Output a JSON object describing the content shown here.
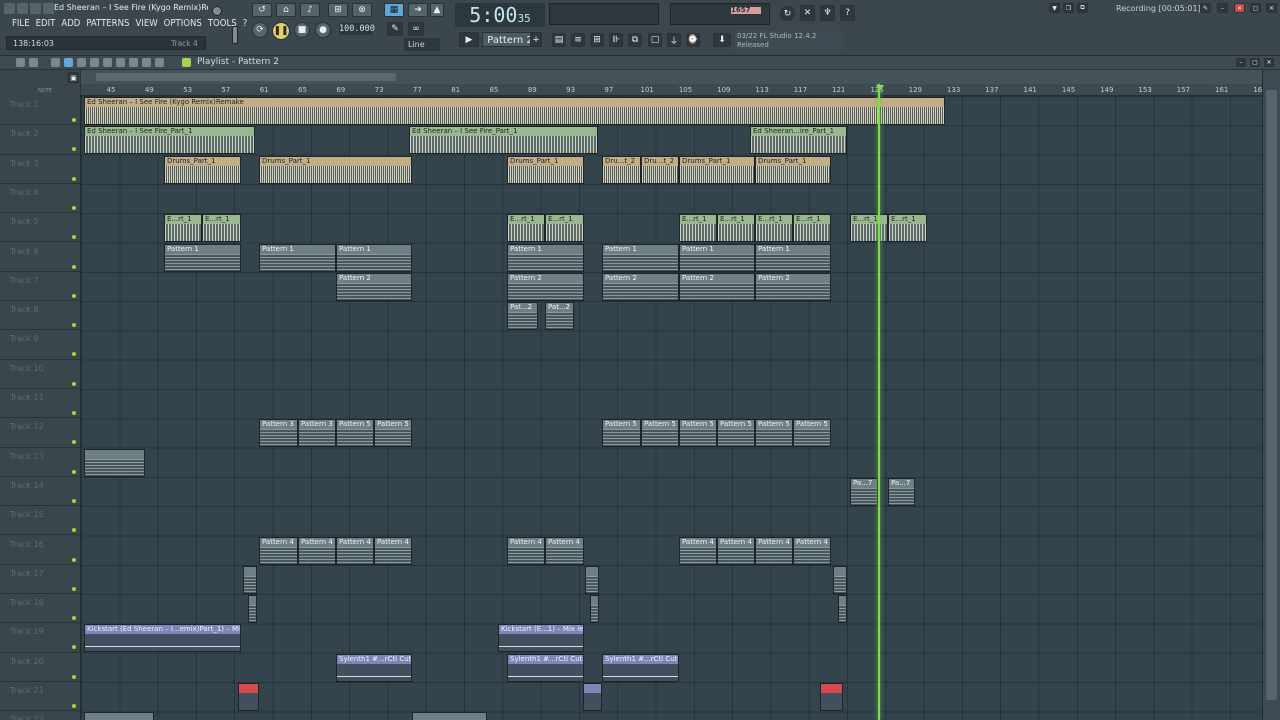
{
  "window": {
    "title": "Ed Sheeran – I See Fire (Kygo Remix)Remake"
  },
  "menu": [
    "FILE",
    "EDIT",
    "ADD",
    "PATTERNS",
    "VIEW",
    "OPTIONS",
    "TOOLS",
    "?"
  ],
  "status": {
    "time": "138:16:03",
    "hint_track": "Track 4"
  },
  "transport": {
    "time_main": "5:00",
    "time_sub": "35",
    "tempo": "100.000",
    "pattern": "Pattern 2",
    "snap": "Line"
  },
  "cpu": {
    "value": "1657"
  },
  "hint_panel": {
    "line1": "03/22  FL Studio 12.4.2",
    "line2": "Released"
  },
  "recording": "Recording [00:05:01]",
  "playlist": {
    "title": "Playlist - Pattern 2",
    "bars": [
      "45",
      "49",
      "53",
      "57",
      "61",
      "65",
      "69",
      "73",
      "77",
      "81",
      "85",
      "89",
      "93",
      "97",
      "101",
      "105",
      "109",
      "113",
      "117",
      "121",
      "125",
      "129",
      "133",
      "137",
      "141",
      "145",
      "149",
      "153",
      "157",
      "161",
      "165"
    ],
    "tracks": [
      "Track 1",
      "Track 2",
      "Track 3",
      "Track 4",
      "Track 5",
      "Track 6",
      "Track 7",
      "Track 8",
      "Track 9",
      "Track 10",
      "Track 11",
      "Track 12",
      "Track 13",
      "Track 14",
      "Track 15",
      "Track 16",
      "Track 17",
      "Track 18",
      "Track 19",
      "Track 20",
      "Track 21",
      "Track 22"
    ]
  },
  "clips": {
    "t1": "Ed Sheeran – I See Fire (Kygo Remix)Remake",
    "t2a": "Ed Sheeran – I See Fire_Part_1",
    "t2b": "Ed Sheeran – I See Fire_Part_1",
    "t2c": "Ed Sheeran...ire_Part_1",
    "drums": "Drums_Part_1",
    "dru": "Dru...t_2",
    "er": "E...rt_1",
    "p1": "Pattern 1",
    "p2": "Pattern 2",
    "pat2": "Pat...2",
    "p3": "Pattern 3",
    "p5": "Pattern 5",
    "p4": "Pattern 4",
    "pa7": "Pa...7",
    "ks1": "Kickstart (Ed Sheeran – I...emix)Part_1) – Mix level",
    "ks2": "Kickstart (E...1) – Mix level",
    "syl": "Sylenth1 #...rCtl Cutoff"
  }
}
